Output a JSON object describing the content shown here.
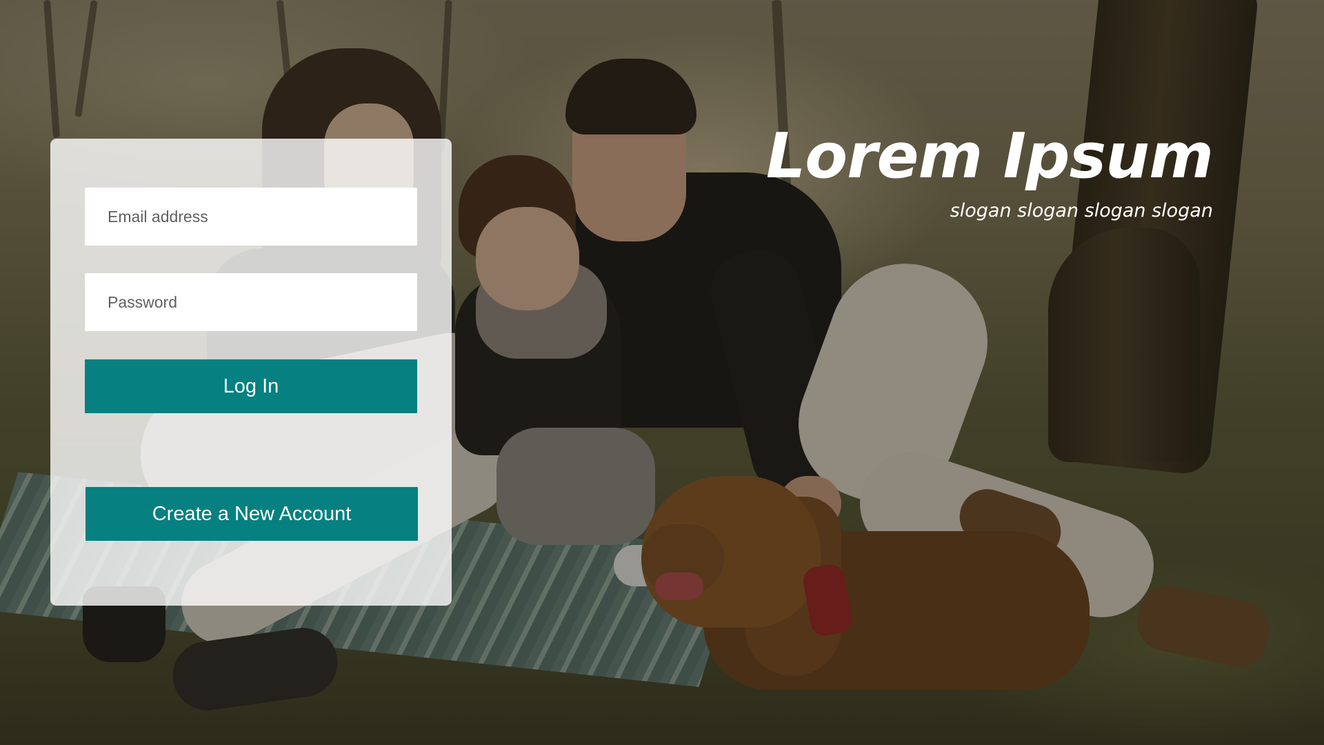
{
  "background": {
    "image_icon": "family-picnic-photo",
    "overlay_color": "#16140c"
  },
  "login": {
    "email_placeholder": "Email address",
    "email_value": "",
    "password_placeholder": "Password",
    "password_value": "",
    "login_label": "Log In",
    "create_account_label": "Create a New Account"
  },
  "brand": {
    "title": "Lorem Ipsum",
    "slogan": "slogan slogan slogan slogan"
  },
  "colors": {
    "primary_button": "#068080",
    "card_background": "#ffffff",
    "text_on_button": "#ffffff"
  }
}
